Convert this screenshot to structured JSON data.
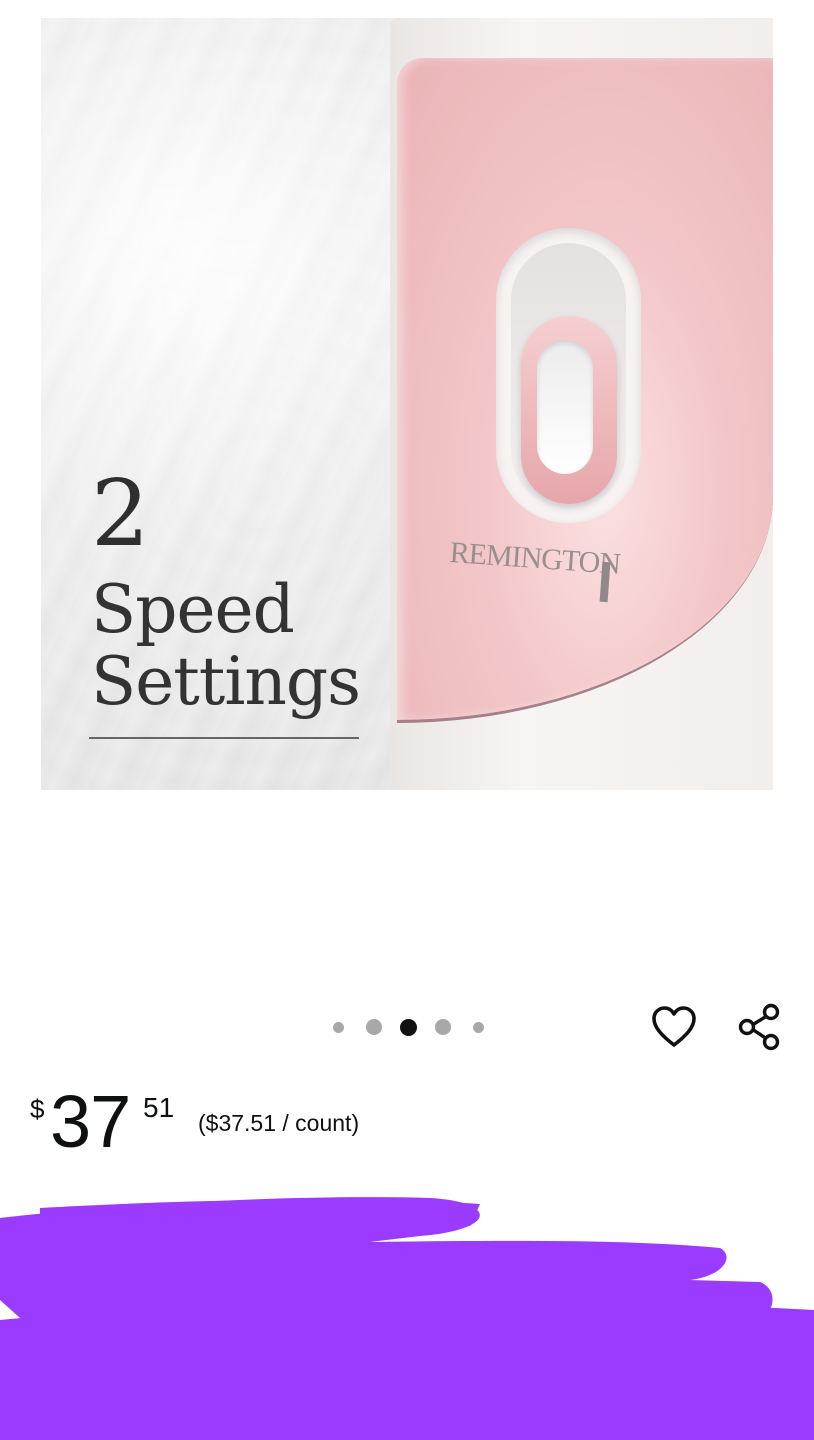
{
  "product_image": {
    "feature_number": "2",
    "feature_line1": "Speed",
    "feature_line2": "Settings",
    "brand_logo": "REMINGTON",
    "colors": {
      "panel_pink": "#f3c7c9",
      "device_white": "#f5f3f1"
    }
  },
  "carousel": {
    "dot_count": 5,
    "active_index": 2
  },
  "actions": {
    "wishlist_icon": "heart-icon",
    "share_icon": "share-icon"
  },
  "price": {
    "symbol": "$",
    "whole": "37",
    "fraction": "51",
    "per_unit": "($37.51 / count)"
  },
  "redaction": {
    "color": "#9b3bff"
  }
}
